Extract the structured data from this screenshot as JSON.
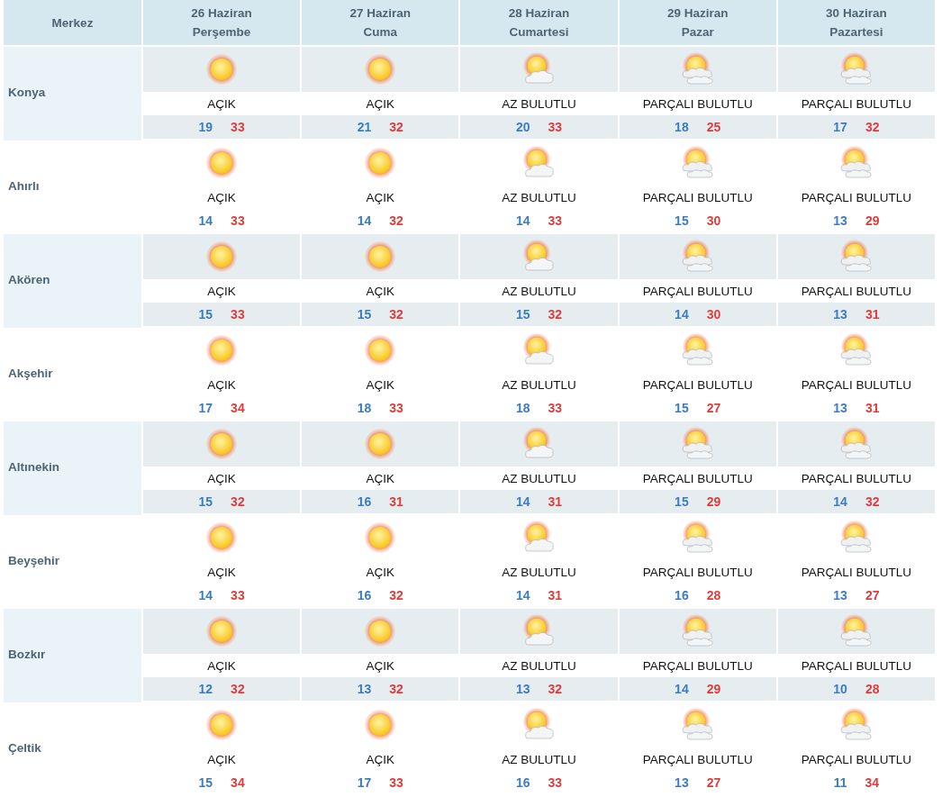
{
  "header": {
    "location_label": "Merkez",
    "days": [
      {
        "date": "26 Haziran",
        "weekday": "Perşembe"
      },
      {
        "date": "27 Haziran",
        "weekday": "Cuma"
      },
      {
        "date": "28 Haziran",
        "weekday": "Cumartesi"
      },
      {
        "date": "29 Haziran",
        "weekday": "Pazar"
      },
      {
        "date": "30 Haziran",
        "weekday": "Pazartesi"
      }
    ]
  },
  "rows": [
    {
      "city": "Konya",
      "forecasts": [
        {
          "kind": "clear",
          "condition": "AÇIK",
          "low": "19",
          "high": "33"
        },
        {
          "kind": "clear",
          "condition": "AÇIK",
          "low": "21",
          "high": "32"
        },
        {
          "kind": "few-clouds",
          "condition": "AZ BULUTLU",
          "low": "20",
          "high": "33"
        },
        {
          "kind": "partly-cloudy",
          "condition": "PARÇALI BULUTLU",
          "low": "18",
          "high": "25"
        },
        {
          "kind": "partly-cloudy",
          "condition": "PARÇALI BULUTLU",
          "low": "17",
          "high": "32"
        }
      ]
    },
    {
      "city": "Ahırlı",
      "forecasts": [
        {
          "kind": "clear",
          "condition": "AÇIK",
          "low": "14",
          "high": "33"
        },
        {
          "kind": "clear",
          "condition": "AÇIK",
          "low": "14",
          "high": "32"
        },
        {
          "kind": "few-clouds",
          "condition": "AZ BULUTLU",
          "low": "14",
          "high": "33"
        },
        {
          "kind": "partly-cloudy",
          "condition": "PARÇALI BULUTLU",
          "low": "15",
          "high": "30"
        },
        {
          "kind": "partly-cloudy",
          "condition": "PARÇALI BULUTLU",
          "low": "13",
          "high": "29"
        }
      ]
    },
    {
      "city": "Akören",
      "forecasts": [
        {
          "kind": "clear",
          "condition": "AÇIK",
          "low": "15",
          "high": "33"
        },
        {
          "kind": "clear",
          "condition": "AÇIK",
          "low": "15",
          "high": "32"
        },
        {
          "kind": "few-clouds",
          "condition": "AZ BULUTLU",
          "low": "15",
          "high": "32"
        },
        {
          "kind": "partly-cloudy",
          "condition": "PARÇALI BULUTLU",
          "low": "14",
          "high": "30"
        },
        {
          "kind": "partly-cloudy",
          "condition": "PARÇALI BULUTLU",
          "low": "13",
          "high": "31"
        }
      ]
    },
    {
      "city": "Akşehir",
      "forecasts": [
        {
          "kind": "clear",
          "condition": "AÇIK",
          "low": "17",
          "high": "34"
        },
        {
          "kind": "clear",
          "condition": "AÇIK",
          "low": "18",
          "high": "33"
        },
        {
          "kind": "few-clouds",
          "condition": "AZ BULUTLU",
          "low": "18",
          "high": "33"
        },
        {
          "kind": "partly-cloudy",
          "condition": "PARÇALI BULUTLU",
          "low": "15",
          "high": "27"
        },
        {
          "kind": "partly-cloudy",
          "condition": "PARÇALI BULUTLU",
          "low": "13",
          "high": "31"
        }
      ]
    },
    {
      "city": "Altınekin",
      "forecasts": [
        {
          "kind": "clear",
          "condition": "AÇIK",
          "low": "15",
          "high": "32"
        },
        {
          "kind": "clear",
          "condition": "AÇIK",
          "low": "16",
          "high": "31"
        },
        {
          "kind": "few-clouds",
          "condition": "AZ BULUTLU",
          "low": "14",
          "high": "31"
        },
        {
          "kind": "partly-cloudy",
          "condition": "PARÇALI BULUTLU",
          "low": "15",
          "high": "29"
        },
        {
          "kind": "partly-cloudy",
          "condition": "PARÇALI BULUTLU",
          "low": "14",
          "high": "32"
        }
      ]
    },
    {
      "city": "Beyşehir",
      "forecasts": [
        {
          "kind": "clear",
          "condition": "AÇIK",
          "low": "14",
          "high": "33"
        },
        {
          "kind": "clear",
          "condition": "AÇIK",
          "low": "16",
          "high": "32"
        },
        {
          "kind": "few-clouds",
          "condition": "AZ BULUTLU",
          "low": "14",
          "high": "31"
        },
        {
          "kind": "partly-cloudy",
          "condition": "PARÇALI BULUTLU",
          "low": "16",
          "high": "28"
        },
        {
          "kind": "partly-cloudy",
          "condition": "PARÇALI BULUTLU",
          "low": "13",
          "high": "27"
        }
      ]
    },
    {
      "city": "Bozkır",
      "forecasts": [
        {
          "kind": "clear",
          "condition": "AÇIK",
          "low": "12",
          "high": "32"
        },
        {
          "kind": "clear",
          "condition": "AÇIK",
          "low": "13",
          "high": "32"
        },
        {
          "kind": "few-clouds",
          "condition": "AZ BULUTLU",
          "low": "13",
          "high": "32"
        },
        {
          "kind": "partly-cloudy",
          "condition": "PARÇALI BULUTLU",
          "low": "14",
          "high": "29"
        },
        {
          "kind": "partly-cloudy",
          "condition": "PARÇALI BULUTLU",
          "low": "10",
          "high": "28"
        }
      ]
    },
    {
      "city": "Çeltik",
      "forecasts": [
        {
          "kind": "clear",
          "condition": "AÇIK",
          "low": "15",
          "high": "34"
        },
        {
          "kind": "clear",
          "condition": "AÇIK",
          "low": "17",
          "high": "33"
        },
        {
          "kind": "few-clouds",
          "condition": "AZ BULUTLU",
          "low": "16",
          "high": "33"
        },
        {
          "kind": "partly-cloudy",
          "condition": "PARÇALI BULUTLU",
          "low": "13",
          "high": "27"
        },
        {
          "kind": "partly-cloudy",
          "condition": "PARÇALI BULUTLU",
          "low": "11",
          "high": "34"
        }
      ]
    }
  ]
}
